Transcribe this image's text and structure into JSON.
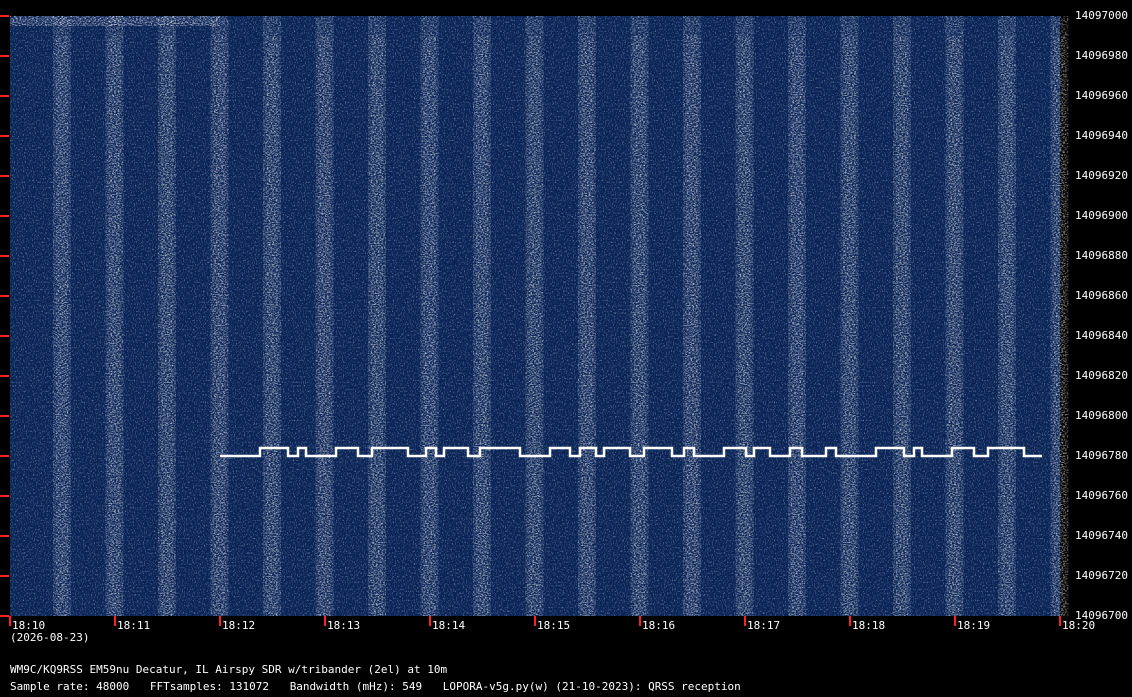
{
  "chart_data": {
    "type": "heatmap",
    "title": "",
    "xlabel": "",
    "ylabel": "",
    "x_ticks": [
      "18:10",
      "18:11",
      "18:12",
      "18:13",
      "18:14",
      "18:15",
      "18:16",
      "18:17",
      "18:18",
      "18:19",
      "18:20"
    ],
    "y_ticks": [
      14097000,
      14096980,
      14096960,
      14096940,
      14096920,
      14096900,
      14096880,
      14096860,
      14096840,
      14096820,
      14096800,
      14096780,
      14096760,
      14096740,
      14096720,
      14096700
    ],
    "ylim": [
      14096700,
      14097000
    ],
    "x_range": [
      "18:10",
      "18:20"
    ],
    "colors": {
      "background": "#0a2456",
      "signal": "#ffffff",
      "tick_marks": "#ff2020",
      "text": "#ffffff"
    },
    "visible_traces": [
      {
        "description": "FSK CW trace",
        "freq_low": 14096780,
        "freq_high": 14096784,
        "start": "18:12",
        "end": "18:20"
      }
    ]
  },
  "date_label": "(2026-08-23)",
  "station_line": "WM9C/KQ9RSS EM59nu Decatur, IL  Airspy SDR w/tribander (2el) at 10m",
  "info_line": {
    "sample_rate": "Sample rate: 48000",
    "fft_samples": "FFTsamples: 131072",
    "bandwidth": "Bandwidth (mHz): 549",
    "software": "LOPORA-v5g.py(w) (21-10-2023): QRSS reception"
  }
}
